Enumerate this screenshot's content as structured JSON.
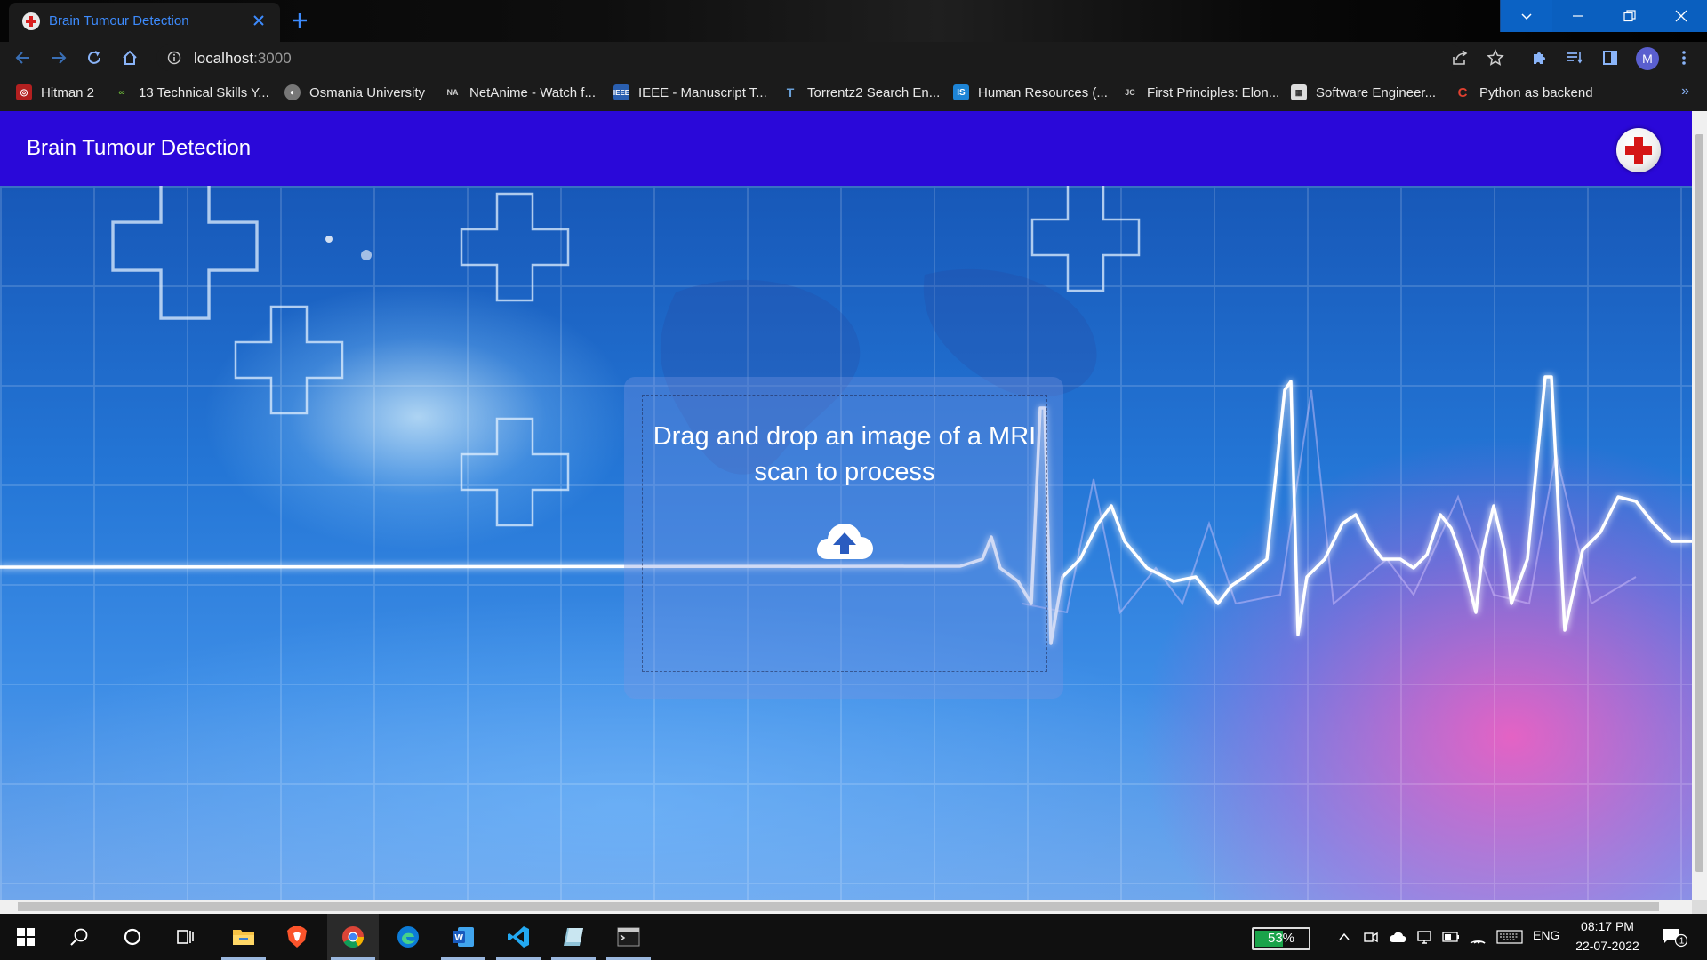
{
  "browser": {
    "tab_title": "Brain Tumour Detection",
    "url_host": "localhost",
    "url_port": ":3000",
    "profile_initial": "M"
  },
  "bookmarks": [
    {
      "label": "Hitman 2",
      "icon": "hitman-icon",
      "color": "#b32020"
    },
    {
      "label": "13 Technical Skills Y...",
      "icon": "link-icon",
      "color": "#4a8f2a"
    },
    {
      "label": "Osmania University",
      "icon": "globe-icon",
      "color": "#777777"
    },
    {
      "label": "NetAnime - Watch f...",
      "icon": "netanime-icon",
      "color": "#333333"
    },
    {
      "label": "IEEE - Manuscript T...",
      "icon": "ieee-icon",
      "color": "#2a5fb0"
    },
    {
      "label": "Torrentz2 Search En...",
      "icon": "torrentz-icon",
      "color": "#555555"
    },
    {
      "label": "Human Resources (...",
      "icon": "hr-icon",
      "color": "#1d84d6"
    },
    {
      "label": "First Principles: Elon...",
      "icon": "jc-icon",
      "color": "#333333"
    },
    {
      "label": "Software Engineer...",
      "icon": "swe-icon",
      "color": "#dddddd"
    },
    {
      "label": "Python as backend",
      "icon": "python-icon",
      "color": "#d33a2c"
    }
  ],
  "app": {
    "title": "Brain Tumour Detection",
    "drop_text": "Drag and drop an image of a MRI scan to process",
    "brand_color": "#2a08d9"
  },
  "taskbar": {
    "battery": "53%",
    "language": "ENG",
    "time": "08:17 PM",
    "date": "22-07-2022",
    "notifications": "1"
  }
}
